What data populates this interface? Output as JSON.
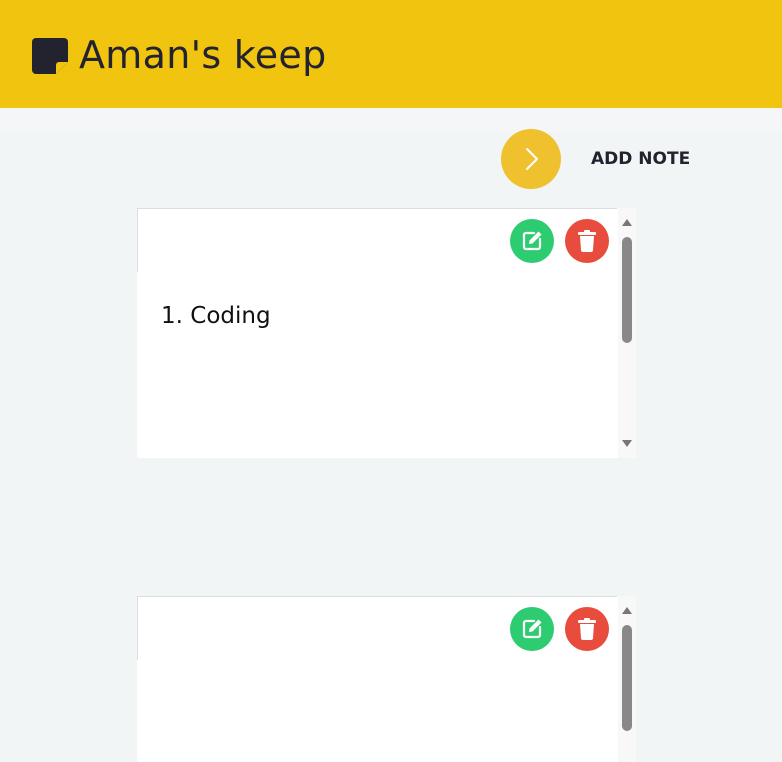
{
  "header": {
    "title": "Aman's keep",
    "bg_color": "#f1c40f",
    "logo_icon": "sticky-note-icon"
  },
  "toolbar": {
    "add_label": "ADD NOTE",
    "add_icon": "chevron-right-icon",
    "accent": "#f0c12f"
  },
  "notes": [
    {
      "content": "1. Coding",
      "edit_icon": "edit-icon",
      "delete_icon": "trash-icon"
    },
    {
      "content": "",
      "edit_icon": "edit-icon",
      "delete_icon": "trash-icon"
    }
  ],
  "colors": {
    "edit": "#2ecc71",
    "delete": "#e74c3c",
    "background": "#f2f5f6"
  }
}
